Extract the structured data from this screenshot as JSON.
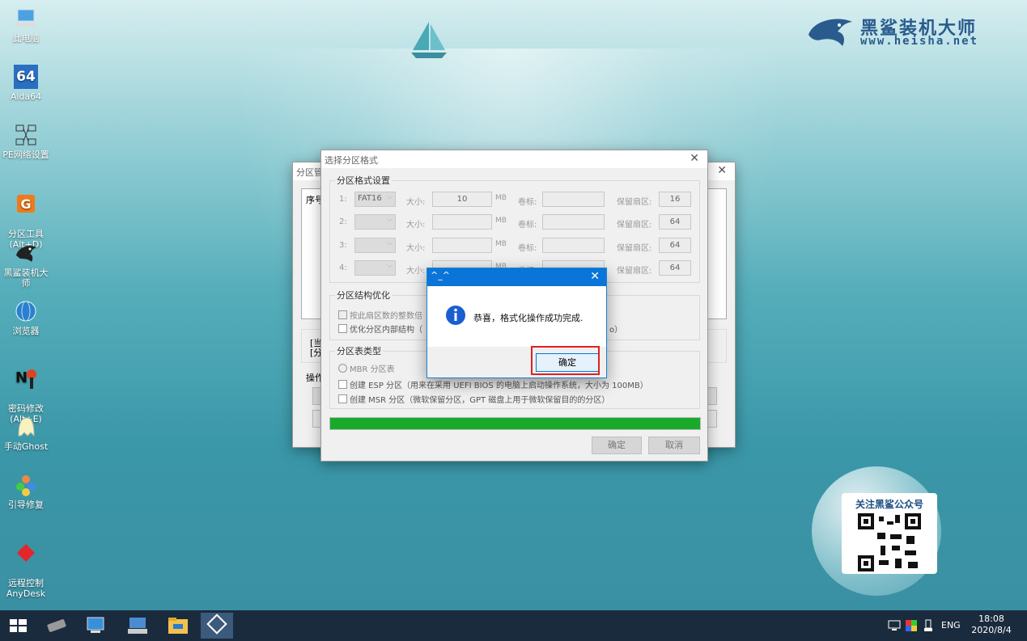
{
  "desktop": {
    "icons": [
      {
        "label": "此电脑",
        "icon": "computer-icon"
      },
      {
        "label": "Aida64",
        "icon": "aida64-icon"
      },
      {
        "label": "PE网络设置",
        "icon": "network-icon"
      },
      {
        "label": "分区工具\n(Alt+D)",
        "icon": "partition-tool-icon"
      },
      {
        "label": "黑鲨装机大师",
        "icon": "shark-icon"
      },
      {
        "label": "浏览器",
        "icon": "browser-icon"
      },
      {
        "label": "密码修改\n(Alt+E)",
        "icon": "password-icon"
      },
      {
        "label": "手动Ghost",
        "icon": "ghost-icon"
      },
      {
        "label": "引导修复",
        "icon": "boot-repair-icon"
      },
      {
        "label": "远程控制\nAnyDesk",
        "icon": "anydesk-icon"
      }
    ],
    "aida_text": "64",
    "brand": {
      "title": "黑鲨装机大师",
      "url": "www.heisha.net"
    },
    "qr": {
      "title": "关注黑鲨公众号"
    }
  },
  "bg_window": {
    "title": "分区管",
    "col_header": "序号",
    "info1": "[当",
    "info2": "[分",
    "ops_label": "操作"
  },
  "format_dialog": {
    "title": "选择分区格式",
    "group1_label": "分区格式设置",
    "size_label": "大小:",
    "mb": "MB",
    "vol_label": "卷标:",
    "reserved_label": "保留扇区:",
    "rows": [
      {
        "num": "1:",
        "fs": "FAT16",
        "size": "10",
        "reserved": "16"
      },
      {
        "num": "2:",
        "fs": "",
        "size": "",
        "reserved": "64"
      },
      {
        "num": "3:",
        "fs": "",
        "size": "",
        "reserved": "64"
      },
      {
        "num": "4:",
        "fs": "",
        "size": "",
        "reserved": "64"
      }
    ],
    "group2_label": "分区结构优化",
    "opt1": "按此扇区数的整数倍",
    "opt2": "优化分区内部结构（",
    "opt2_tail": "o）",
    "group3_label": "分区表类型",
    "mbr": "MBR 分区表",
    "esp": "创建 ESP 分区（用来在采用 UEFI BIOS 的电脑上启动操作系统，大小为 100MB）",
    "msr": "创建 MSR 分区（微软保留分区，GPT 磁盘上用于微软保留目的的分区）",
    "progress": 1.0,
    "ok": "确定",
    "cancel": "取消"
  },
  "message_box": {
    "title": "^_^",
    "text": "恭喜，格式化操作成功完成.",
    "ok": "确定"
  },
  "taskbar": {
    "time": "18:08",
    "date": "2020/8/4",
    "lang": "ENG"
  },
  "colors": {
    "progress": "#1aaa2a",
    "title_blue": "#0b74d8",
    "highlight": "#e02020"
  }
}
